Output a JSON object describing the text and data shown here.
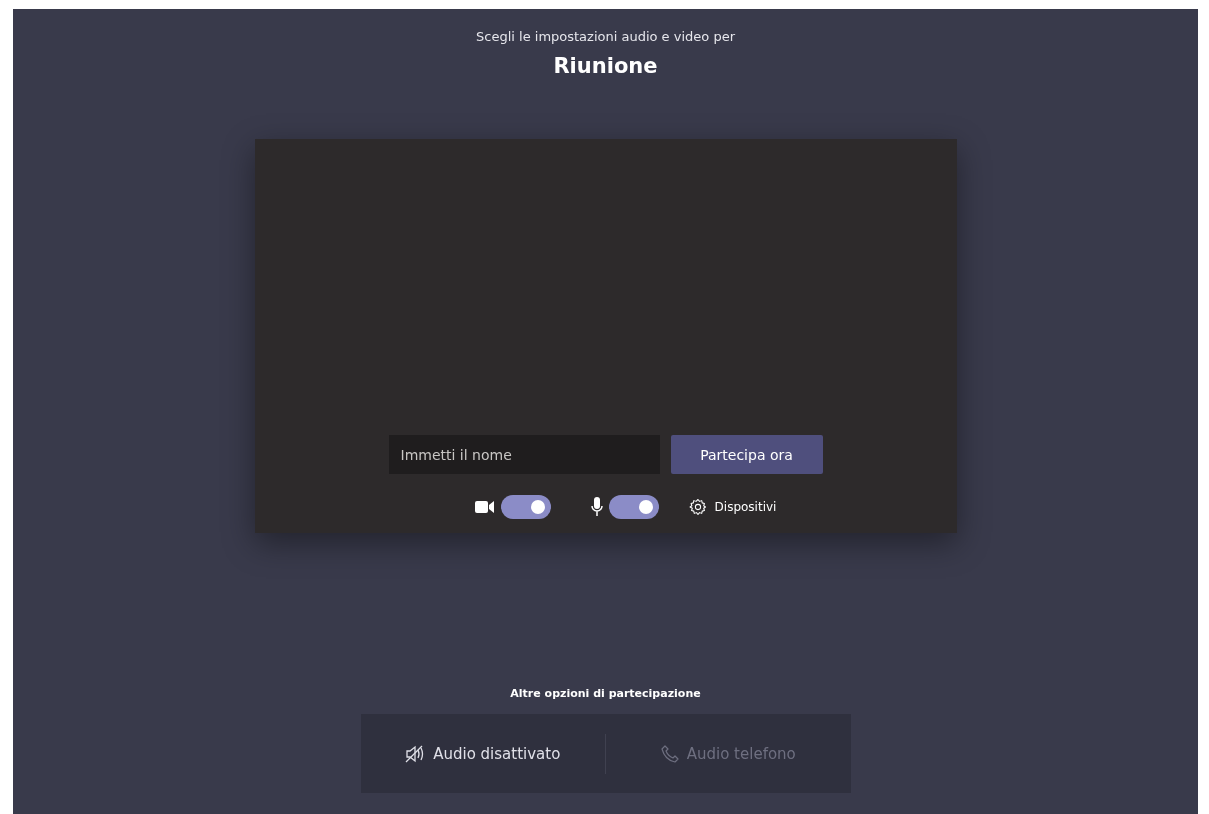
{
  "header": {
    "subtitle": "Scegli le impostazioni audio e video per",
    "title": "Riunione"
  },
  "join": {
    "name_field": {
      "placeholder": "Immetti il nome"
    },
    "join_button": "Partecipa ora"
  },
  "controls": {
    "camera": {
      "on": true
    },
    "microphone": {
      "on": true
    },
    "devices_label": "Dispositivi"
  },
  "other_options": {
    "title": "Altre opzioni di partecipazione",
    "options": [
      {
        "kind": "audio-off",
        "label": "Audio disattivato",
        "disabled": false
      },
      {
        "kind": "phone",
        "label": "Audio telefono",
        "disabled": true
      }
    ]
  }
}
